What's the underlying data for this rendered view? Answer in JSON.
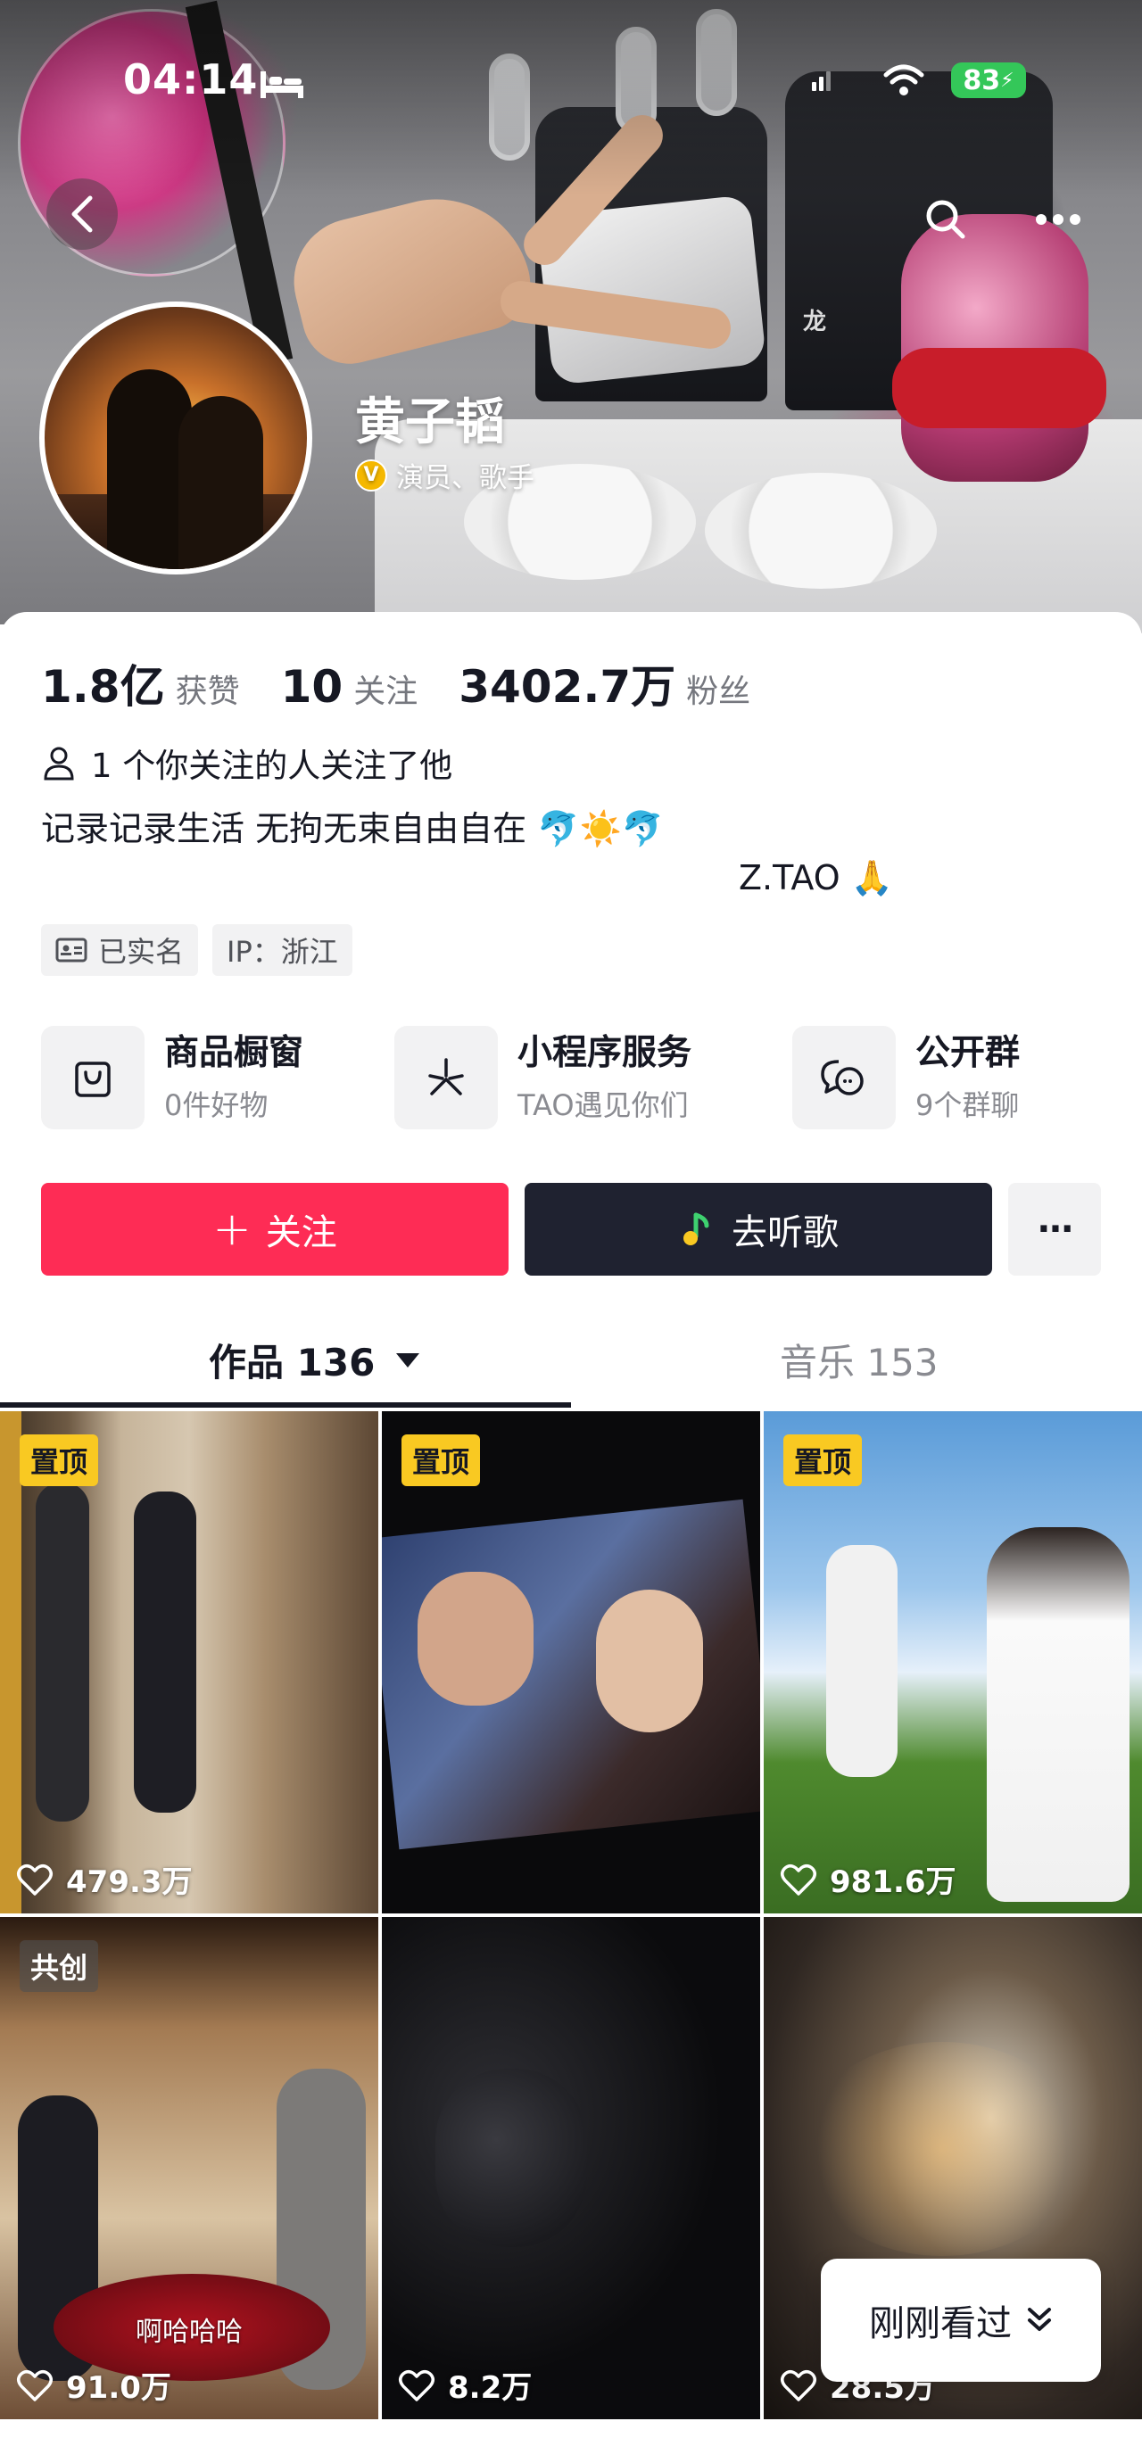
{
  "status_bar": {
    "time": "04:14",
    "battery": "83"
  },
  "profile": {
    "name": "黄子韬",
    "verification": "演员、歌手",
    "verify_badge": "V"
  },
  "cover_text": "龙",
  "stats": [
    {
      "value": "1.8亿",
      "label": "获赞"
    },
    {
      "value": "10",
      "label": "关注"
    },
    {
      "value": "3402.7万",
      "label": "粉丝"
    }
  ],
  "mutual_text": "1 个你关注的人关注了他",
  "bio": {
    "line1": "记录记录生活 无拘无束自由自在 🐬☀️🐬",
    "signature": "Z.TAO 🙏"
  },
  "tags": {
    "verified": "已实名",
    "ip": "IP：浙江"
  },
  "services": [
    {
      "title": "商品橱窗",
      "sub": "0件好物",
      "icon": "shopping-bag-icon"
    },
    {
      "title": "小程序服务",
      "sub": "TAO遇见你们",
      "icon": "mini-program-icon"
    },
    {
      "title": "公开群",
      "sub": "9个群聊",
      "icon": "group-chat-icon"
    }
  ],
  "actions": {
    "follow": "关注",
    "follow_plus": "+",
    "listen": "去听歌",
    "more": "···"
  },
  "tabs": {
    "works": "作品 136",
    "music": "音乐 153"
  },
  "videos": [
    {
      "badge": "置顶",
      "likes": "479.3万"
    },
    {
      "badge": "置顶",
      "likes": ""
    },
    {
      "badge": "置顶",
      "likes": "981.6万"
    },
    {
      "badge": "共创",
      "likes": "91.0万",
      "caption": "啊哈哈哈"
    },
    {
      "badge": "",
      "likes": "8.2万"
    },
    {
      "badge": "",
      "likes": "28.5万"
    }
  ],
  "recently_viewed": "刚刚看过",
  "colors": {
    "follow_button": "#fe2c55",
    "listen_button": "#1f2230",
    "pin_badge": "#f9c922",
    "battery": "#34c759"
  }
}
